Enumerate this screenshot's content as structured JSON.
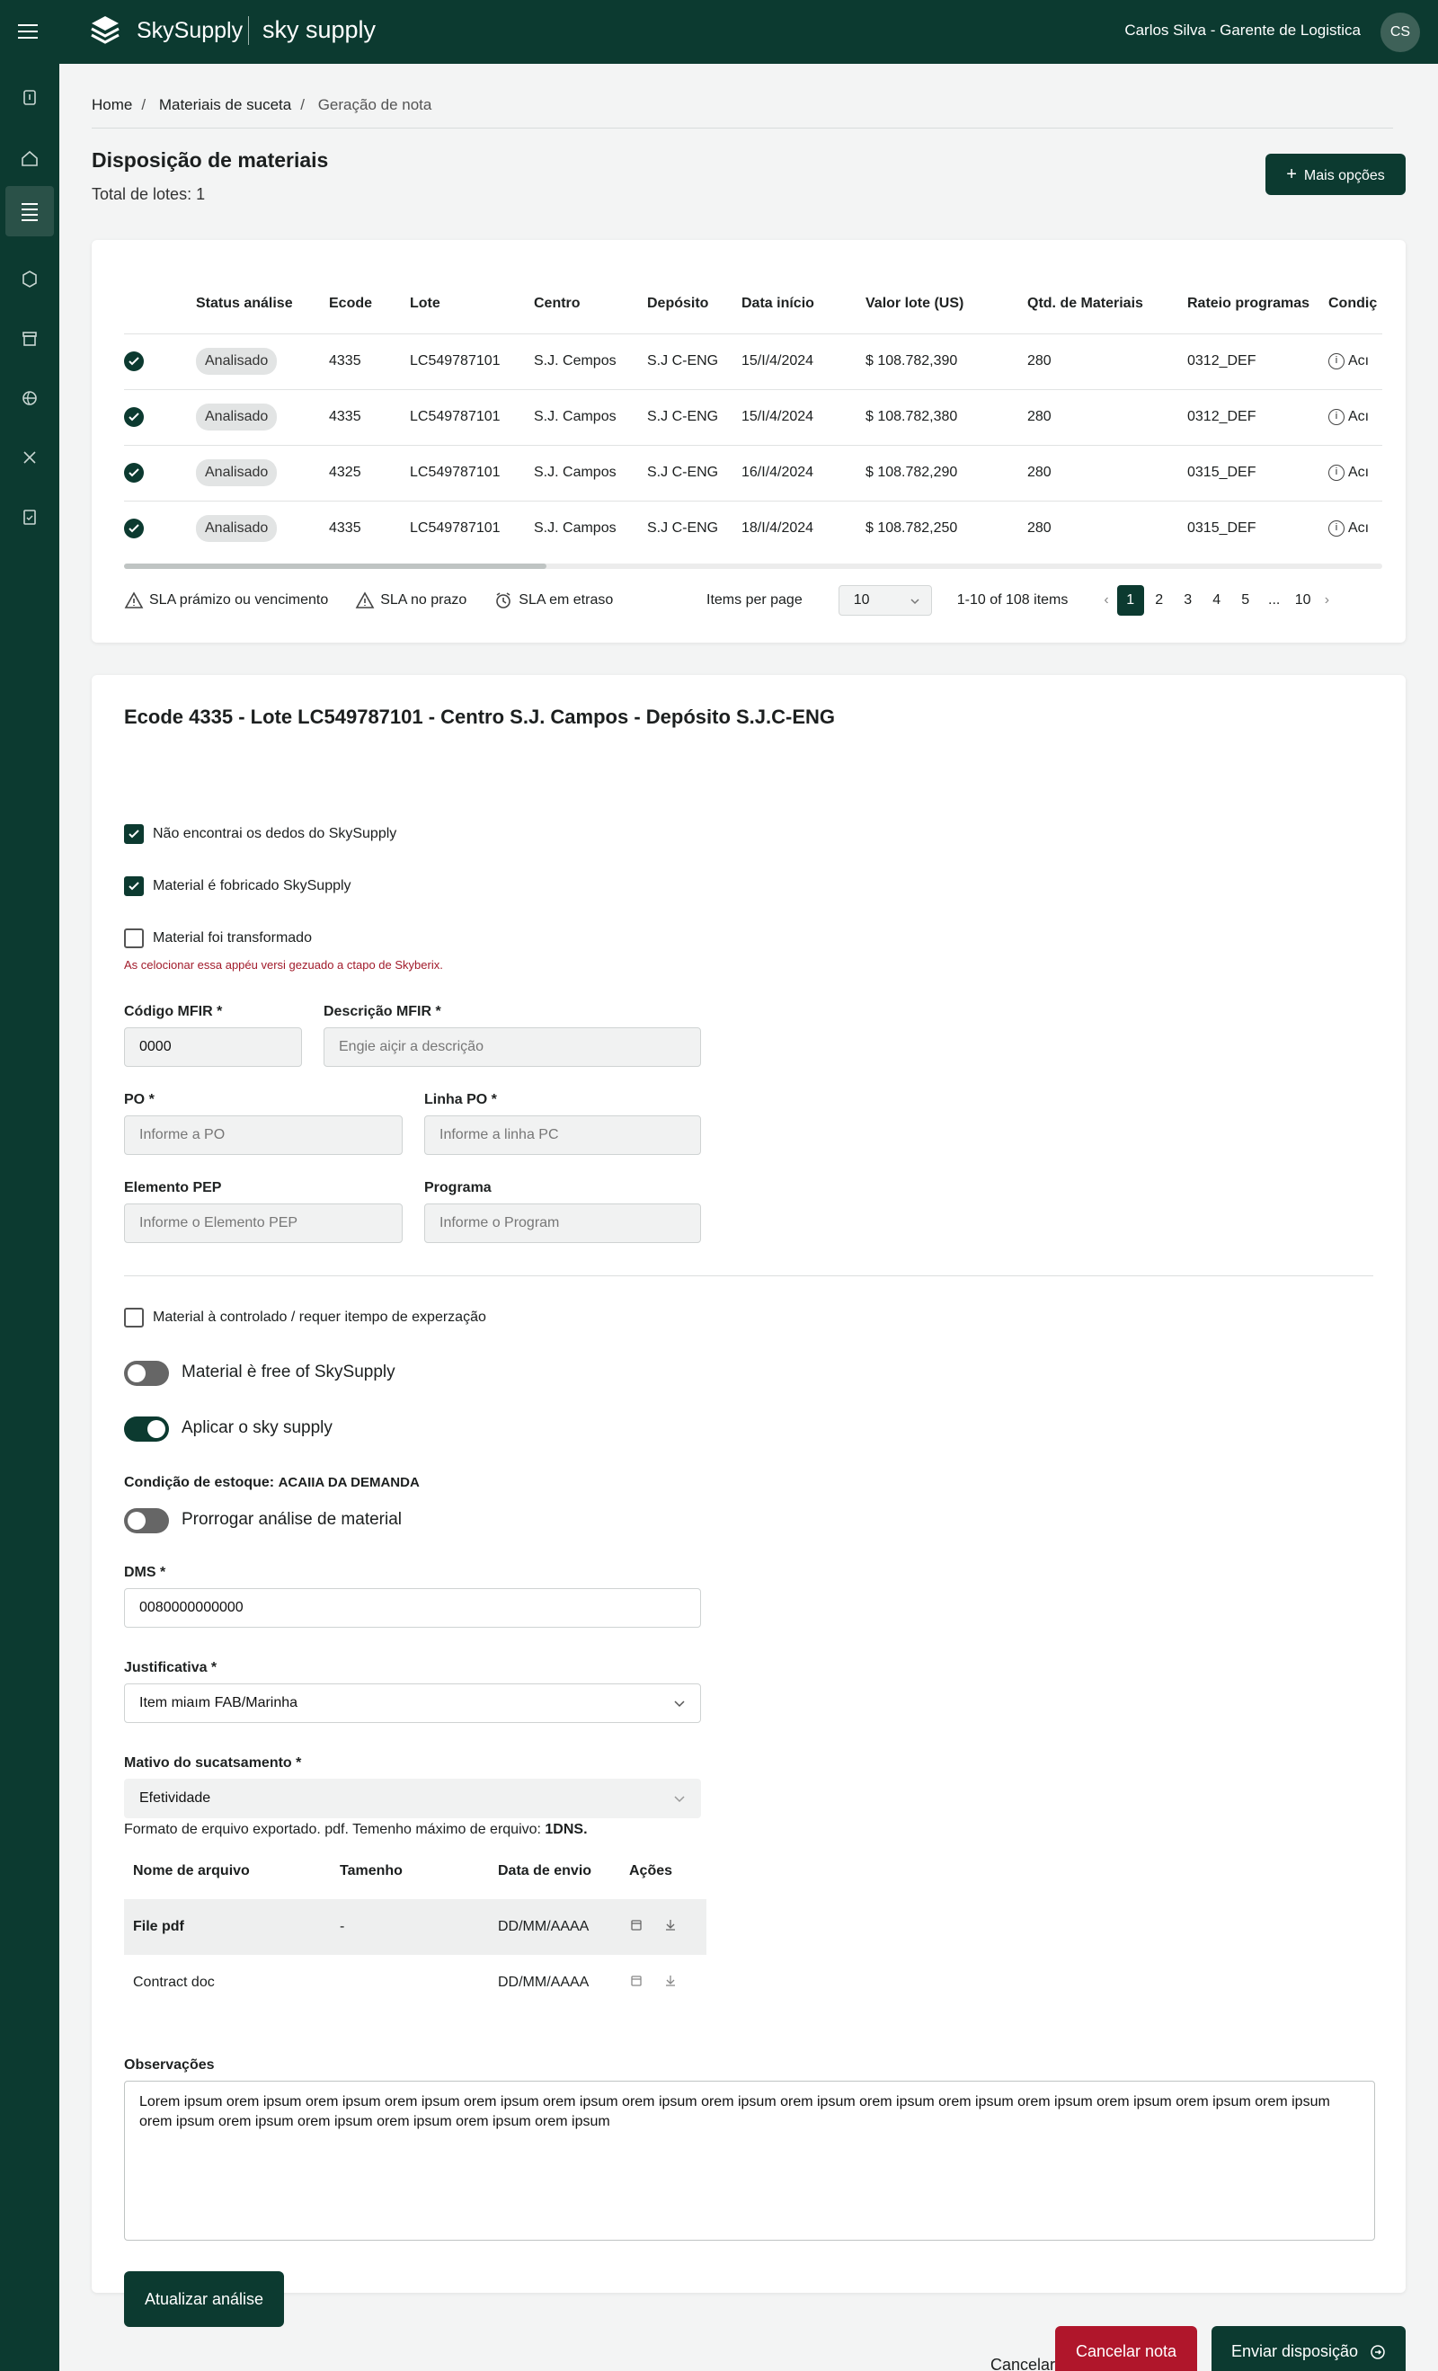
{
  "header": {
    "brand": "SkySupply",
    "app": "sky supply",
    "user": "Carlos Silva - Garente de Logistica",
    "avatar_initials": "CS"
  },
  "breadcrumb": [
    "Home",
    "Materiais de suceta",
    "Geração de nota"
  ],
  "page": {
    "title": "Disposição de materiais",
    "total": "Total de lotes: 1",
    "more_button": "Mais opções"
  },
  "table": {
    "columns": [
      "",
      "Status análise",
      "Ecode",
      "Lote",
      "Centro",
      "Depósito",
      "Data início",
      "Valor lote (US)",
      "Qtd. de Materiais",
      "Rateio programas",
      "Condiç"
    ],
    "rows": [
      {
        "status": "Analisado",
        "ecode": "4335",
        "lote": "LC549787101",
        "centro": "S.J. Cempos",
        "deposito": "S.J C-ENG",
        "data": "15/I/4/2024",
        "valor": "$ 108.782,390",
        "qtd": "280",
        "rateio": "0312_DEF",
        "cond": "Acı"
      },
      {
        "status": "Analisado",
        "ecode": "4335",
        "lote": "LC549787101",
        "centro": "S.J. Campos",
        "deposito": "S.J C-ENG",
        "data": "15/I/4/2024",
        "valor": "$ 108.782,380",
        "qtd": "280",
        "rateio": "0312_DEF",
        "cond": "Acı"
      },
      {
        "status": "Analisado",
        "ecode": "4325",
        "lote": "LC549787101",
        "centro": "S.J. Campos",
        "deposito": "S.J C-ENG",
        "data": "16/I/4/2024",
        "valor": "$ 108.782,290",
        "qtd": "280",
        "rateio": "0315_DEF",
        "cond": "Acı"
      },
      {
        "status": "Analisado",
        "ecode": "4335",
        "lote": "LC549787101",
        "centro": "S.J. Campos",
        "deposito": "S.J C-ENG",
        "data": "18/I/4/2024",
        "valor": "$ 108.782,250",
        "qtd": "280",
        "rateio": "0315_DEF",
        "cond": "Acı"
      }
    ]
  },
  "legend": {
    "sla_near": "SLA prámizo ou vencimento",
    "sla_ok": "SLA no prazo",
    "sla_late": "SLA em etraso"
  },
  "pager": {
    "items_per_page_label": "Items per page",
    "items_per_page": "10",
    "range": "1-10 of 108 items",
    "pages": [
      "1",
      "2",
      "3",
      "4",
      "5",
      "...",
      "10"
    ],
    "current": "1"
  },
  "detail": {
    "title": "Ecode 4335 - Lote LC549787101 - Centro S.J. Campos - Depósito S.J.C-ENG",
    "cb1": "Não encontrai os dedos do SkySupply",
    "cb2": "Material é fobricado SkySupply",
    "cb3": "Material foi transformado",
    "hint": "As celocionar essa appéu versi gezuado a ctapo de Skyberix.",
    "codigo_label": "Código MFIR *",
    "codigo_value": "0000",
    "descricao_label": "Descrição MFIR *",
    "descricao_placeholder": "Engie aiçir a descrição",
    "po_label": "PO *",
    "po_placeholder": "Informe a PO",
    "linha_label": "Linha PO *",
    "linha_placeholder": "Informe a linha PC",
    "pep_label": "Elemento PEP",
    "pep_placeholder": "Informe o Elemento PEP",
    "programa_label": "Programa",
    "programa_placeholder": "Informe o Program",
    "cb4": "Material à controlado / requer itempo de experzação",
    "toggle1": "Material è free of SkySupply",
    "toggle2": "Aplicar o sky supply",
    "cond_label": "Condição de estoque: ",
    "cond_value": "ACAIIA DA DEMANDA",
    "toggle3": "Prorrogar análise de material",
    "dms_label": "DMS *",
    "dms_value": "0080000000000",
    "just_label": "Justificativa *",
    "just_value": "Item miaım FAB/Marinha",
    "motivo_label": "Mativo do sucatsamento *",
    "motivo_value": "Efetividade",
    "format_text": "Formato de erquivo exportado.  pdf. Temenho máximo de erquivo: ",
    "format_strong": "1DNS."
  },
  "files": {
    "columns": [
      "Nome de arquivo",
      "Tamenho",
      "Data de envio",
      "Ações"
    ],
    "rows": [
      {
        "name": "File pdf",
        "size": "-",
        "date": "DD/MM/AAAA"
      },
      {
        "name": "Contract doc",
        "size": "",
        "date": "DD/MM/AAAA"
      }
    ]
  },
  "obs": {
    "label": "Observações",
    "text": "Lorem ipsum orem ipsum orem ipsum orem ipsum orem ipsum orem ipsum orem ipsum orem ipsum orem ipsum orem ipsum orem ipsum orem ipsum orem ipsum orem ipsum orem ipsum orem ipsum orem ipsum orem ipsum orem ipsum orem ipsum orem ipsum"
  },
  "actions": {
    "update": "Atualizar análise",
    "cancel": "Cancelar",
    "cancel_note": "Cancelar nota",
    "send": "Enviar disposição"
  },
  "colors": {
    "primary": "#0c3a30",
    "danger": "#b0162b"
  }
}
